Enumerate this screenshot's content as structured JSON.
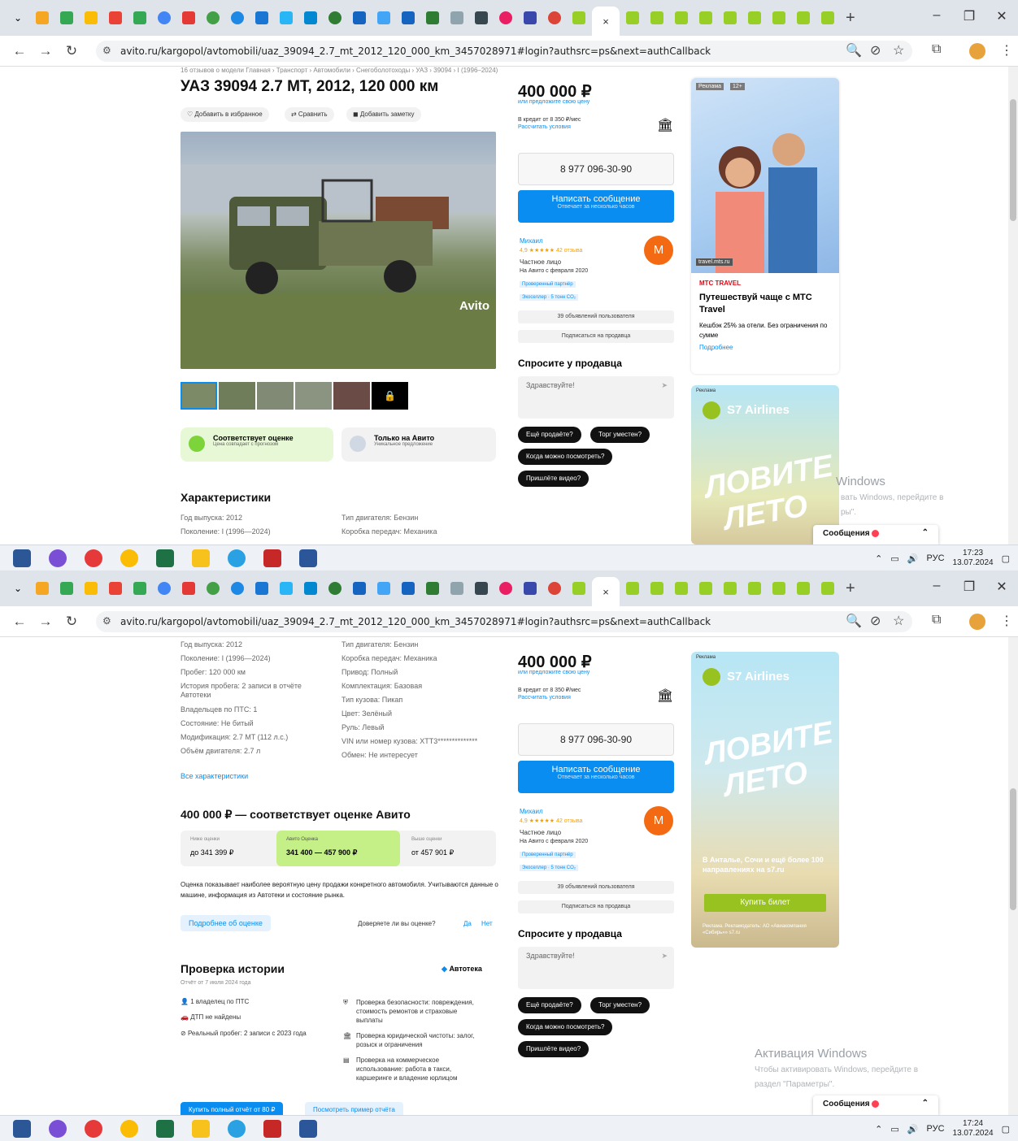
{
  "browser": {
    "url": "avito.ru/kargopol/avtomobili/uaz_39094_2.7_mt_2012_120_000_km_3457028971#login?authsrc=ps&next=authCallback",
    "tab_close": "×",
    "new_tab": "+",
    "minimize": "–",
    "restore": "❐",
    "close": "✕",
    "back": "←",
    "forward": "→",
    "reload": "↻"
  },
  "taskbar": {
    "lang": "РУС",
    "time1": "17:23",
    "date1": "13.07.2024",
    "time2": "17:24",
    "date2": "13.07.2024"
  },
  "top": {
    "breadcrumb": "16 отзывов о модели  Главная › Транспорт › Автомобили › Снегоболотоходы › УАЗ › 39094 › I (1996–2024)",
    "title": "УАЗ 39094 2.7 MT, 2012, 120 000 км",
    "actions": [
      "♡ Добавить в избранное",
      "⇄ Сравнить",
      "◼ Добавить заметку"
    ],
    "watermark": "Avito",
    "badge1_title": "Соответствует оценке",
    "badge1_sub": "Цена совпадает с прогнозом",
    "badge2_title": "Только на Авито",
    "badge2_sub": "Уникальное предложение",
    "specs_title": "Характеристики",
    "spec_left": [
      "Год выпуска: 2012",
      "Поколение: I (1996—2024)"
    ],
    "spec_right": [
      "Тип двигателя: Бензин",
      "Коробка передач: Механика"
    ]
  },
  "seller": {
    "price": "400 000 ₽",
    "price_hint": "или предложите свою цену",
    "credit": "В кредит от 8 350 ₽/мес",
    "credit_link": "Рассчитать условия",
    "phone": "8 977 096-30-90",
    "message": "Написать сообщение",
    "message_sub": "Отвечает за несколько часов",
    "name": "Михаил",
    "rating": "4,9 ★★★★★  42 отзыва",
    "type": "Частное лицо",
    "since": "На Авито с февраля 2020",
    "tag1": "Проверенный партнёр",
    "tag2": "Экоселлер · 5 тонн CO₂",
    "avatar": "М",
    "ads_btn": "39 объявлений пользователя",
    "subscribe_btn": "Подписаться на продавца",
    "ask_title": "Спросите у продавца",
    "ask_placeholder": "Здравствуйте!",
    "chips": [
      "Ещё продаёте?",
      "Торг уместен?",
      "Когда можно посмотреть?",
      "Пришлёте видео?"
    ]
  },
  "ad1": {
    "badge": "Реклама",
    "age": "12+",
    "site": "travel.mts.ru",
    "brand": "МТС TRAVEL",
    "title": "Путешествуй чаще с МТС Travel",
    "text": "Кешбэк 25% за отели. Без ограничения по сумме",
    "more": "Подробнее"
  },
  "ad2": {
    "badge": "Реклама",
    "brand": "S7 Airlines",
    "slogan1": "ЛОВИТЕ",
    "slogan2": "ЛЕТО",
    "promo": "В Анталье, Сочи и ещё более 100 направлениях на s7.ru",
    "cta": "Купить билет",
    "legal": "Реклама. Рекламодатель: АО «Авиакомпания «Сибирь»» s7.ru"
  },
  "bottom": {
    "spec_left": [
      "Год выпуска: 2012",
      "Поколение: I (1996—2024)",
      "Пробег: 120 000 км",
      "История пробега: 2 записи в отчёте Автотеки",
      "Владельцев по ПТС: 1",
      "Состояние: Не битый",
      "Модификация: 2.7 MT (112 л.с.)",
      "Объём двигателя: 2.7 л"
    ],
    "spec_right": [
      "Тип двигателя: Бензин",
      "Коробка передач: Механика",
      "Привод: Полный",
      "Комплектация: Базовая",
      "Тип кузова: Пикап",
      "Цвет: Зелёный",
      "Руль: Левый",
      "VIN или номер кузова: XTT3**************",
      "Обмен: Не интересует"
    ],
    "all_specs": "Все характеристики",
    "eval_title": "400 000 ₽ — соответствует оценке Авито",
    "eval1_label": "Ниже оценки",
    "eval1_val": "до 341 399 ₽",
    "eval2_label": "Авито Оценка",
    "eval2_val": "341 400 — 457 900 ₽",
    "eval3_label": "Выше оценки",
    "eval3_val": "от 457 901 ₽",
    "eval_text": "Оценка показывает наиболее вероятную цену продажи конкретного автомобиля. Учитываются данные о машине, информация из Автотеки и состояние рынка.",
    "eval_more": "Подробнее об оценке",
    "trust_q": "Доверяете ли вы оценке?",
    "yes": "Да",
    "no": "Нет",
    "history_title": "Проверка истории",
    "autoteka": "Автотека",
    "report_date": "Отчёт от 7 июля 2024 года",
    "hist_left": [
      "1 владелец по ПТС",
      "ДТП не найдены",
      "Реальный пробег: 2 записи с 2023 года"
    ],
    "hist_right": [
      "Проверка безопасности: повреждения, стоимость ремонтов и страховые выплаты",
      "Проверка юридической чистоты: залог, розыск и ограничения",
      "Проверка на коммерческое использование: работа в такси, каршеринге и владение юрлицом"
    ],
    "buy_report": "Купить полный отчёт от 80 ₽",
    "sample_report": "Посмотреть пример отчёта"
  },
  "windows": {
    "activate_title": "Активация Windows",
    "activate_text1": "Чтобы активировать Windows, перейдите в",
    "activate_text2": "раздел \"Параметры\".",
    "partial_title": "Windows",
    "partial_text1": "вать Windows, перейдите в",
    "partial_text2": "ры\"."
  },
  "messages": "Сообщения",
  "colors": {
    "accent": "#0a8df0",
    "orange": "#f36a12",
    "green": "#e7f8d6"
  }
}
